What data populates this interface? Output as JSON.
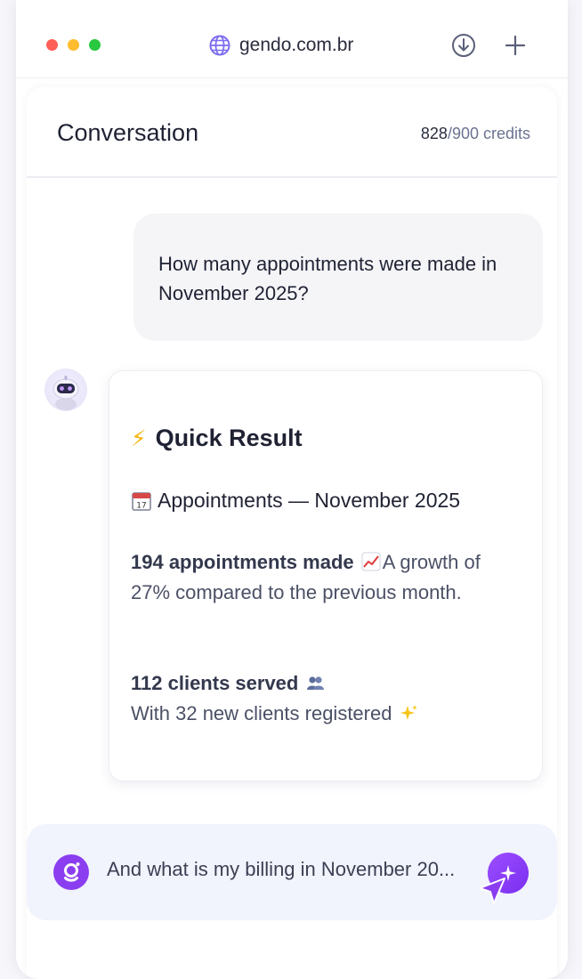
{
  "browser": {
    "url": "gendo.com.br",
    "download_icon": "download-icon",
    "new_tab_icon": "plus-icon"
  },
  "header": {
    "title": "Conversation",
    "credits_used": "828",
    "credits_total": "/900 credits"
  },
  "conversation": {
    "user_message": "How many appointments were made in November 2025?",
    "bot": {
      "title": "Quick Result",
      "appointments_header": "Appointments — November 2025",
      "appointments_bold": "194 appointments made",
      "appointments_text": "A growth of 27% compared to the previous month.",
      "clients_bold": "112 clients served",
      "clients_text": "With 32 new clients registered"
    }
  },
  "composer": {
    "text": "And what is my billing in November 20...",
    "send_icon": "sparkle-icon"
  },
  "colors": {
    "accent": "#8b3df0",
    "composer_bg": "#f1f3fd",
    "user_bubble_bg": "#f5f5f8"
  }
}
